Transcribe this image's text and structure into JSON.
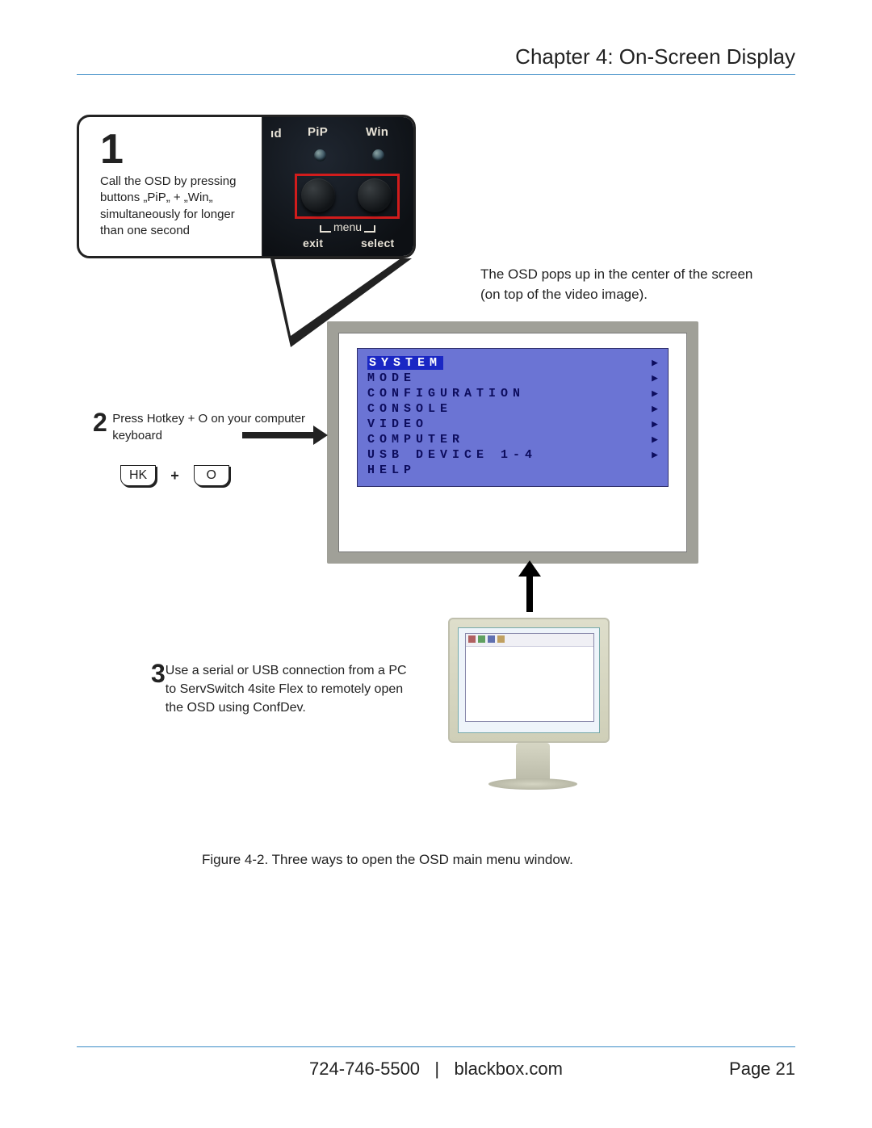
{
  "header": {
    "chapter_title": "Chapter 4: On-Screen Display"
  },
  "step1": {
    "number": "1",
    "text": "Call the OSD by pressing buttons „PiP„ + „Win„ simultaneously for longer than one second",
    "device": {
      "labels": {
        "ld": "ıd",
        "pip": "PiP",
        "win": "Win",
        "menu": "menu",
        "exit": "exit",
        "select": "select"
      }
    }
  },
  "osd_note": "The OSD pops up in the center of the screen (on top of the video image).",
  "osd_menu": {
    "items": [
      {
        "label": "SYSTEM",
        "selected": true
      },
      {
        "label": "MODE"
      },
      {
        "label": "CONFIGURATION"
      },
      {
        "label": "CONSOLE"
      },
      {
        "label": "VIDEO"
      },
      {
        "label": "COMPUTER"
      },
      {
        "label": "USB DEVICE 1-4"
      },
      {
        "label": "HELP"
      }
    ]
  },
  "step2": {
    "number": "2",
    "text": "Press Hotkey + O on your computer keyboard",
    "key1": "HK",
    "plus": "+",
    "key2": "O"
  },
  "step3": {
    "number": "3",
    "text": "Use a serial or USB connection from a PC to ServSwitch 4site Flex to remotely open the OSD using ConfDev."
  },
  "figure_caption": "Figure 4-2. Three ways to open the OSD main menu window.",
  "footer": {
    "phone": "724-746-5500",
    "site": "blackbox.com",
    "separator": "|",
    "page_label": "Page 21"
  }
}
